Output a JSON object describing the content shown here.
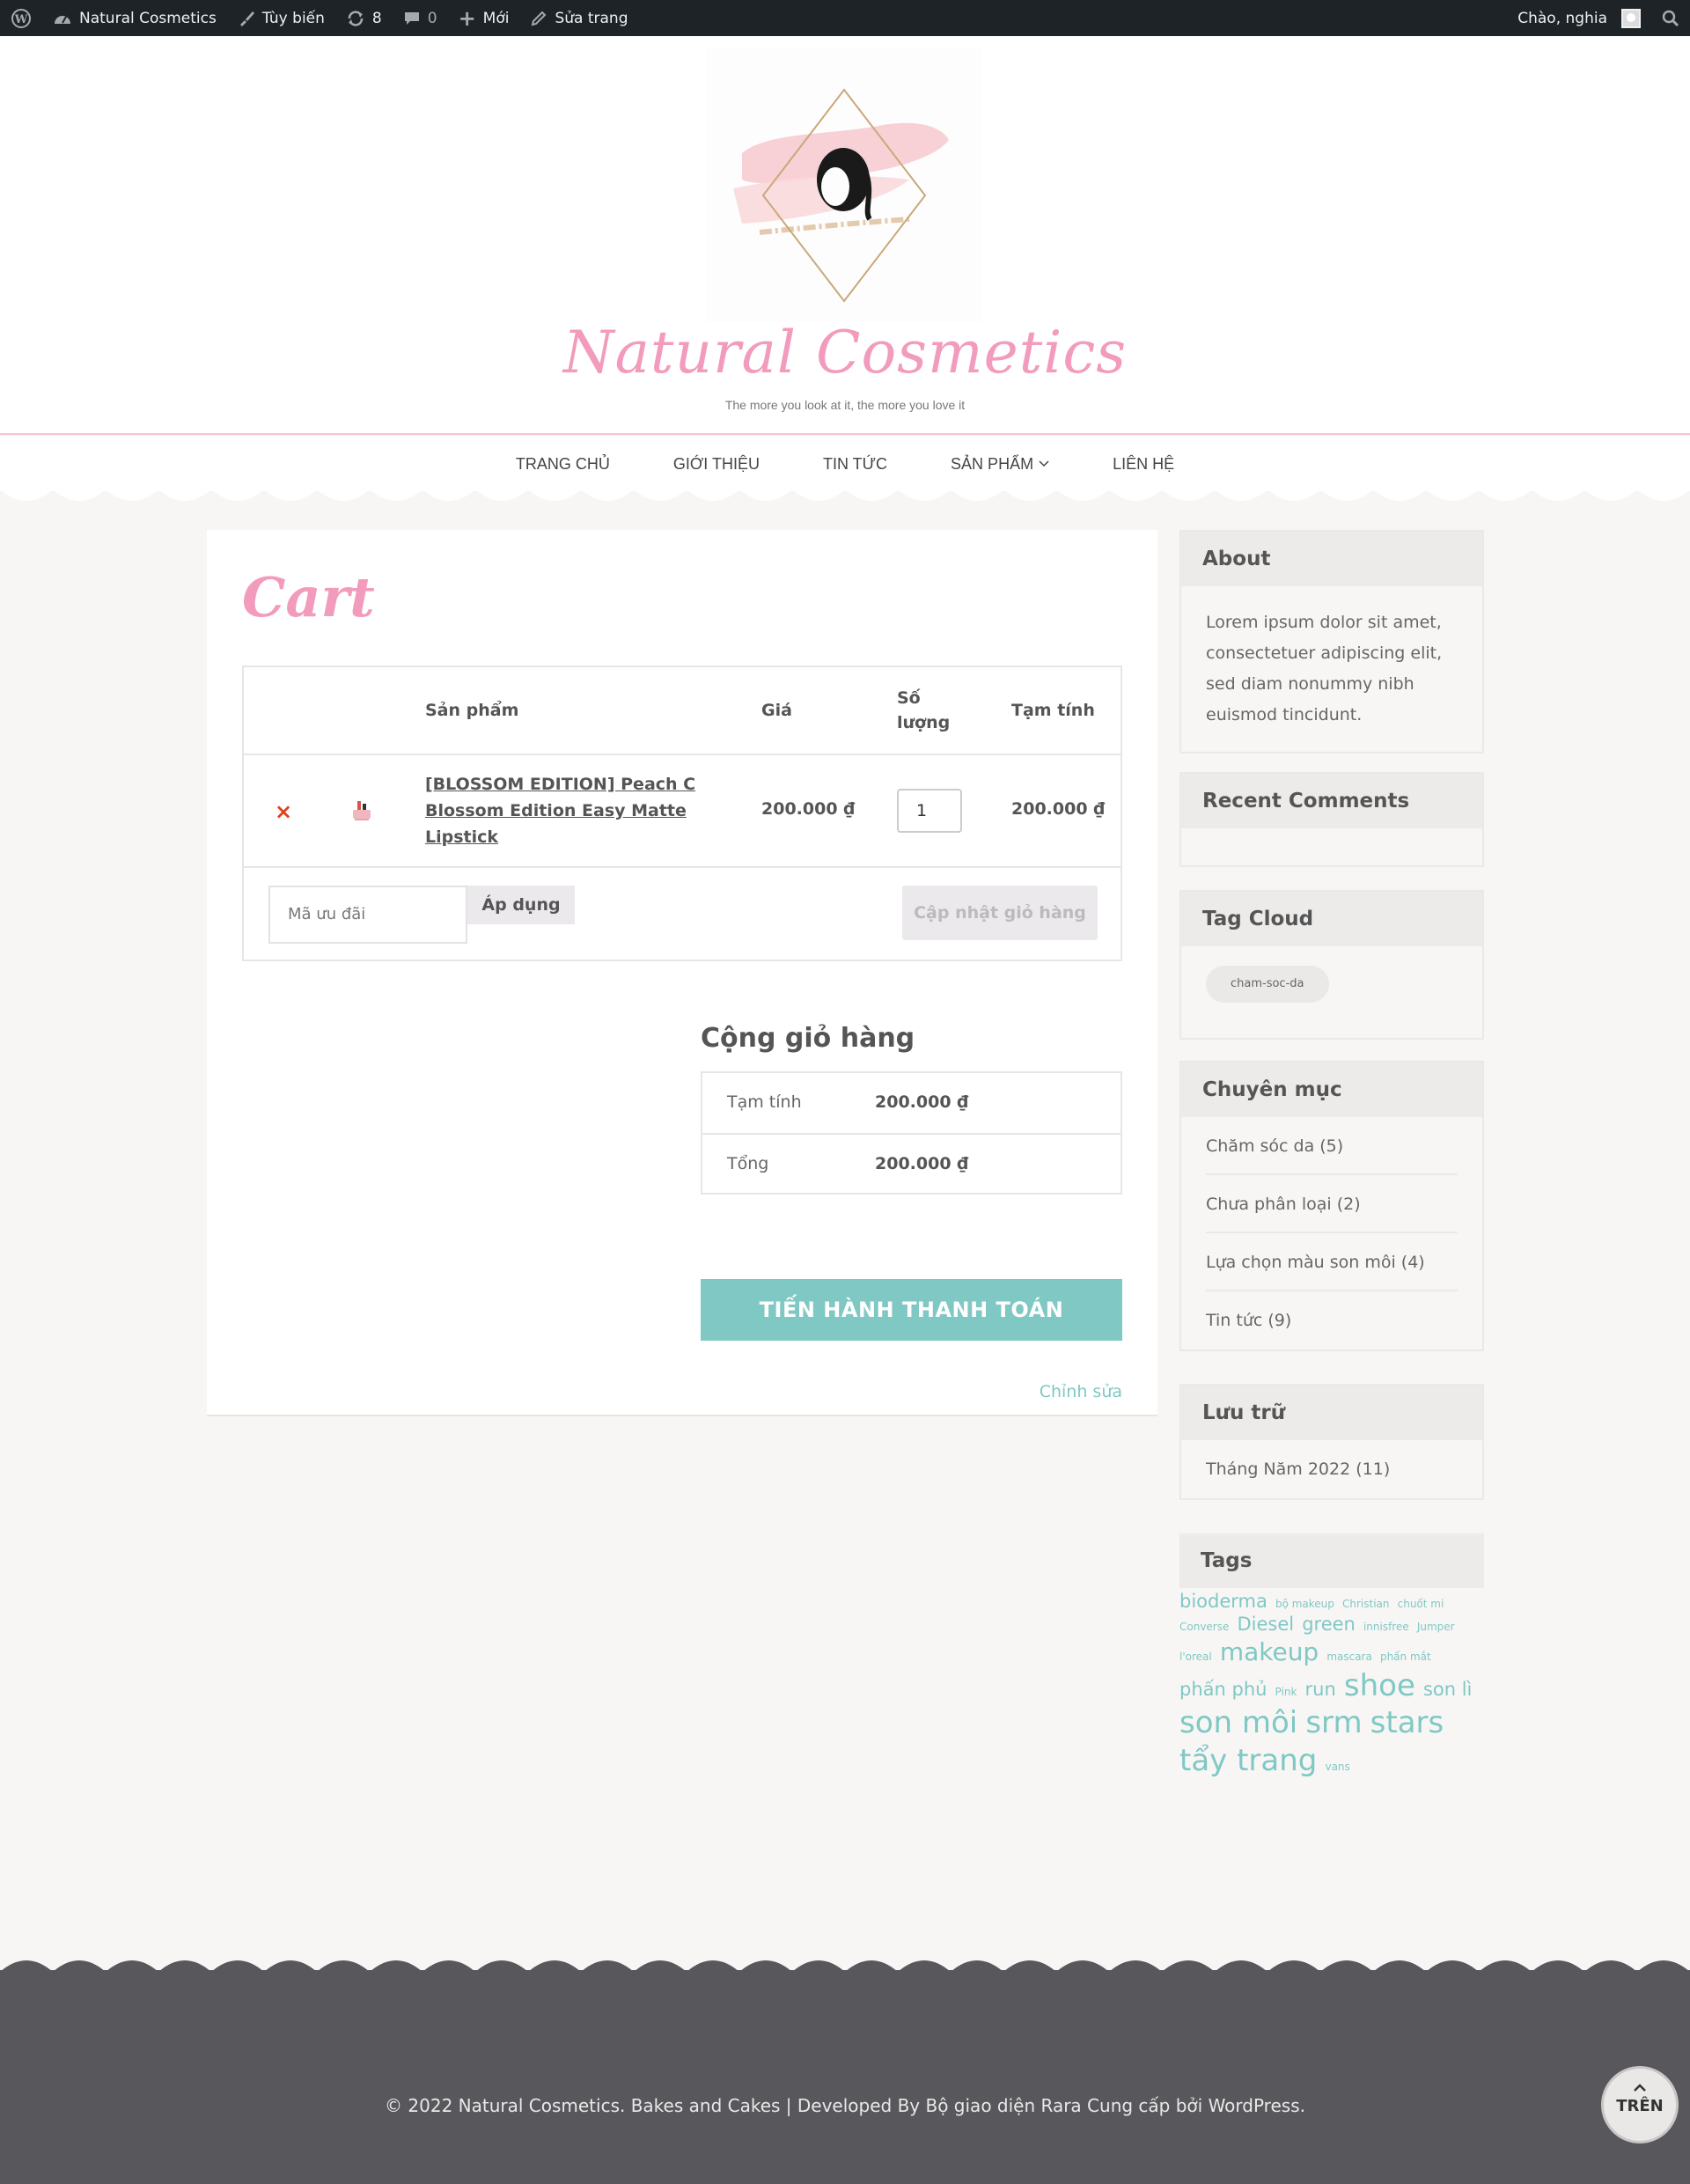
{
  "adminbar": {
    "wp_logo_icon": "wordpress-icon",
    "site_name": "Natural Cosmetics",
    "customize": "Tùy biến",
    "updates_count": "8",
    "comments_count": "0",
    "new": "Mới",
    "edit_page": "Sửa trang",
    "greeting": "Chào, nghia"
  },
  "header": {
    "title": "Natural Cosmetics",
    "tagline": "The more you look at it, the more you love it"
  },
  "nav": {
    "items": [
      "TRANG CHỦ",
      "GIỚI THIỆU",
      "TIN TỨC",
      "SẢN PHẨM",
      "LIÊN HỆ"
    ]
  },
  "page": {
    "title": "Cart"
  },
  "cart": {
    "headers": {
      "product": "Sản phẩm",
      "price": "Giá",
      "quantity": "Số lượng",
      "subtotal": "Tạm tính"
    },
    "items": [
      {
        "remove": "×",
        "name": "[BLOSSOM EDITION] Peach C Blossom Edition Easy Matte Lipstick",
        "price": "200.000 ₫",
        "quantity": "1",
        "subtotal": "200.000 ₫"
      }
    ],
    "coupon_placeholder": "Mã ưu đãi",
    "apply_label": "Áp dụng",
    "update_label": "Cập nhật giỏ hàng"
  },
  "totals": {
    "title": "Cộng giỏ hàng",
    "subtotal_label": "Tạm tính",
    "subtotal_value": "200.000 ₫",
    "total_label": "Tổng",
    "total_value": "200.000 ₫",
    "checkout_label": "TIẾN HÀNH THANH TOÁN",
    "edit_label": "Chỉnh sửa"
  },
  "sidebar": {
    "about": {
      "title": "About",
      "text": "Lorem ipsum dolor sit amet, consectetuer adipiscing elit, sed diam nonummy nibh euismod tincidunt."
    },
    "recent_comments": {
      "title": "Recent Comments"
    },
    "tag_cloud": {
      "title": "Tag Cloud",
      "tags": [
        "cham-soc-da"
      ]
    },
    "categories": {
      "title": "Chuyên mục",
      "items": [
        "Chăm sóc da (5)",
        "Chưa phân loại (2)",
        "Lựa chọn màu son môi (4)",
        "Tin tức (9)"
      ]
    },
    "archives": {
      "title": "Lưu trữ",
      "items": [
        "Tháng Năm 2022 (11)"
      ]
    },
    "tags": {
      "title": "Tags",
      "items": [
        {
          "label": "bioderma",
          "size": "large"
        },
        {
          "label": "bộ makeup",
          "size": "small"
        },
        {
          "label": "Christian",
          "size": "small"
        },
        {
          "label": "chuốt mi",
          "size": "small"
        },
        {
          "label": "Converse",
          "size": "small"
        },
        {
          "label": "Diesel",
          "size": "large"
        },
        {
          "label": "green",
          "size": "large"
        },
        {
          "label": "innisfree",
          "size": "small"
        },
        {
          "label": "Jumper",
          "size": "small"
        },
        {
          "label": "l'oreal",
          "size": "small"
        },
        {
          "label": "makeup",
          "size": "xlarge"
        },
        {
          "label": "mascara",
          "size": "small"
        },
        {
          "label": "phấn mắt",
          "size": "small"
        },
        {
          "label": "phấn phủ",
          "size": "large"
        },
        {
          "label": "Pink",
          "size": "small"
        },
        {
          "label": "run",
          "size": "large"
        },
        {
          "label": "shoe",
          "size": "xxlarge"
        },
        {
          "label": "son lì",
          "size": "large"
        },
        {
          "label": "son môi",
          "size": "xxlarge"
        },
        {
          "label": "srm",
          "size": "xxlarge"
        },
        {
          "label": "stars",
          "size": "xxlarge"
        },
        {
          "label": "tẩy trang",
          "size": "xxlarge"
        },
        {
          "label": "vans",
          "size": "small"
        }
      ]
    }
  },
  "footer": {
    "text": "© 2022 Natural Cosmetics. Bakes and Cakes | Developed By Bộ giao diện Rara Cung cấp bởi WordPress.",
    "to_top": "TRÊN"
  },
  "colors": {
    "brand_pink": "#f29bbd",
    "accent_teal": "#7fc8c4",
    "adminbar": "#1d2327",
    "footer_bg": "#58575c",
    "remove_red": "#e2401c"
  }
}
